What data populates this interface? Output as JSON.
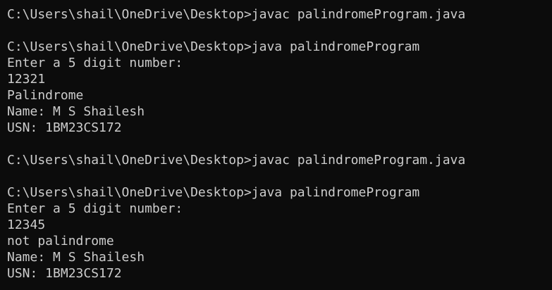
{
  "terminal": {
    "lines": [
      "C:\\Users\\shail\\OneDrive\\Desktop>javac palindromeProgram.java",
      "",
      "C:\\Users\\shail\\OneDrive\\Desktop>java palindromeProgram",
      "Enter a 5 digit number:",
      "12321",
      "Palindrome",
      "Name: M S Shailesh",
      "USN: 1BM23CS172",
      "",
      "C:\\Users\\shail\\OneDrive\\Desktop>javac palindromeProgram.java",
      "",
      "C:\\Users\\shail\\OneDrive\\Desktop>java palindromeProgram",
      "Enter a 5 digit number:",
      "12345",
      "not palindrome",
      "Name: M S Shailesh",
      "USN: 1BM23CS172"
    ]
  },
  "colors": {
    "background": "#0c0c0c",
    "text": "#cccccc"
  }
}
